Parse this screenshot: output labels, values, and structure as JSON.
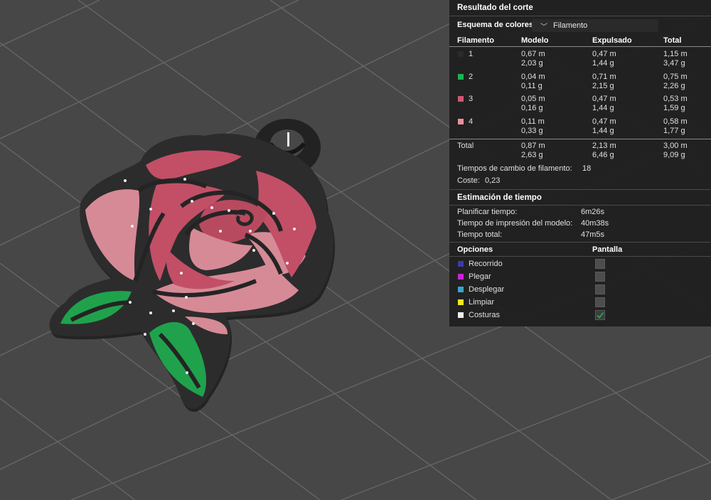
{
  "result_panel": {
    "title": "Resultado del corte",
    "color_scheme_label": "Esquema de colores",
    "color_scheme_value": "Filamento",
    "columns": [
      "Filamento",
      "Modelo",
      "Expulsado",
      "Total"
    ],
    "filaments": [
      {
        "id": "1",
        "color": "#2b2b2b",
        "model_m": "0,67 m",
        "model_g": "2,03 g",
        "purged_m": "0,47 m",
        "purged_g": "1,44 g",
        "total_m": "1,15 m",
        "total_g": "3,47 g"
      },
      {
        "id": "2",
        "color": "#1bb453",
        "model_m": "0,04 m",
        "model_g": "0,11 g",
        "purged_m": "0,71 m",
        "purged_g": "2,15 g",
        "total_m": "0,75 m",
        "total_g": "2,26 g"
      },
      {
        "id": "3",
        "color": "#d0576e",
        "model_m": "0,05 m",
        "model_g": "0,16 g",
        "purged_m": "0,47 m",
        "purged_g": "1,44 g",
        "total_m": "0,53 m",
        "total_g": "1,59 g"
      },
      {
        "id": "4",
        "color": "#e9909e",
        "model_m": "0,11 m",
        "model_g": "0,33 g",
        "purged_m": "0,47 m",
        "purged_g": "1,44 g",
        "total_m": "0,58 m",
        "total_g": "1,77 g"
      }
    ],
    "total": {
      "label": "Total",
      "model_m": "0,87 m",
      "model_g": "2,63 g",
      "purged_m": "2,13 m",
      "purged_g": "6,46 g",
      "total_m": "3,00 m",
      "total_g": "9,09 g"
    },
    "filament_changes_label": "Tiempos de cambio de filamento:",
    "filament_changes_value": "18",
    "cost_label": "Coste:",
    "cost_value": "0,23"
  },
  "time_estimate": {
    "title": "Estimación de tiempo",
    "rows": [
      {
        "label": "Planificar tiempo:",
        "value": "6m26s"
      },
      {
        "label": "Tiempo de impresión del modelo:",
        "value": "40m38s"
      },
      {
        "label": "Tiempo total:",
        "value": "47m5s"
      }
    ]
  },
  "options": {
    "header_options": "Opciones",
    "header_display": "Pantalla",
    "items": [
      {
        "label": "Recorrido",
        "color": "#3d3aa8",
        "checked": false
      },
      {
        "label": "Plegar",
        "color": "#c726d6",
        "checked": false
      },
      {
        "label": "Desplegar",
        "color": "#3aa3c8",
        "checked": false
      },
      {
        "label": "Limpiar",
        "color": "#f2e91a",
        "checked": false
      },
      {
        "label": "Costuras",
        "color": "#ececec",
        "checked": true
      }
    ]
  },
  "icons": {
    "dropdown": "chevron-down-icon",
    "check": "check-icon"
  },
  "colors": {
    "bed": "#474747",
    "grid_line": "#6b6b6b",
    "model_base": "#262626",
    "leaf": "#1fa24c",
    "petal_dark": "#c45066",
    "petal_light": "#d98a96"
  }
}
